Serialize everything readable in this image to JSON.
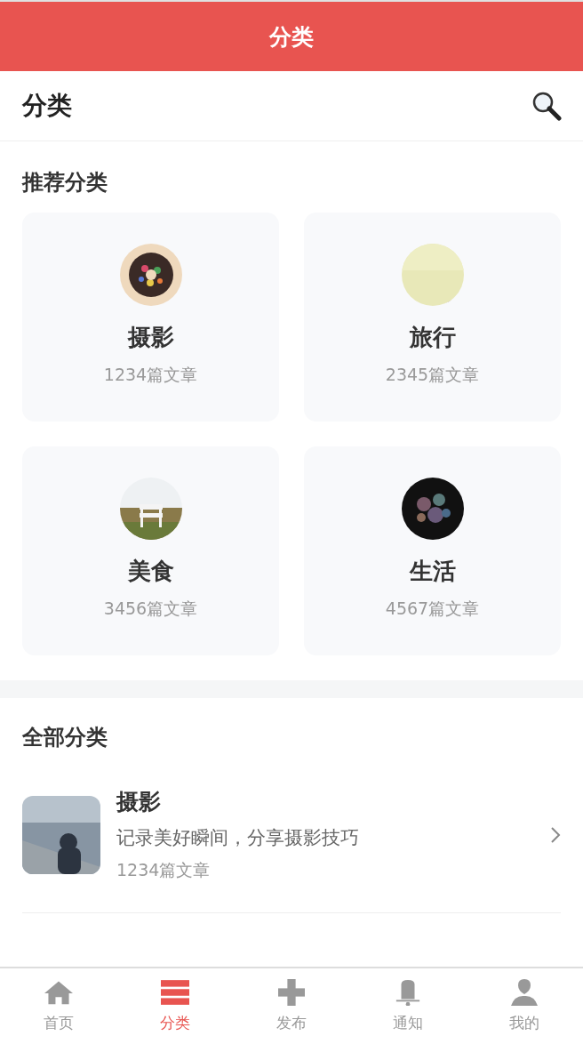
{
  "header": {
    "title": "分类"
  },
  "subheader": {
    "title": "分类"
  },
  "recommended": {
    "title": "推荐分类",
    "items": [
      {
        "name": "摄影",
        "count": "1234篇文章"
      },
      {
        "name": "旅行",
        "count": "2345篇文章"
      },
      {
        "name": "美食",
        "count": "3456篇文章"
      },
      {
        "name": "生活",
        "count": "4567篇文章"
      }
    ]
  },
  "all": {
    "title": "全部分类",
    "items": [
      {
        "name": "摄影",
        "description": "记录美好瞬间，分享摄影技巧",
        "count": "1234篇文章"
      }
    ]
  },
  "tabs": [
    {
      "label": "首页",
      "selected": false
    },
    {
      "label": "分类",
      "selected": true
    },
    {
      "label": "发布",
      "selected": false
    },
    {
      "label": "通知",
      "selected": false
    },
    {
      "label": "我的",
      "selected": false
    }
  ]
}
